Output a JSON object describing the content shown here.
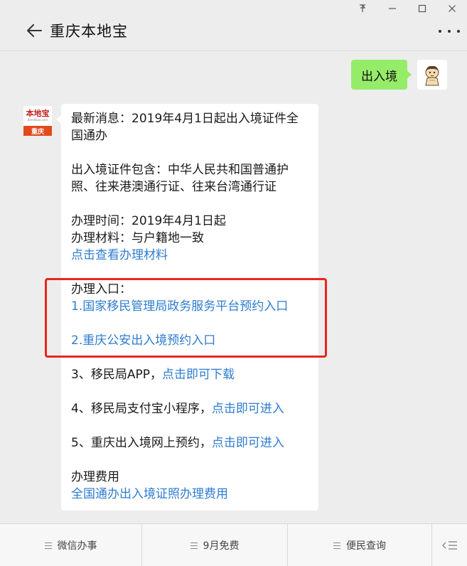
{
  "header": {
    "title": "重庆本地宝"
  },
  "chat": {
    "outgoing": {
      "text": "出入境"
    },
    "bot_avatar": {
      "logo_text": "本地宝",
      "logo_sub": "Bendibao.com",
      "city": "重庆"
    },
    "incoming": {
      "line1": "最新消息：2019年4月1日起出入境证件全",
      "line2": "国通办",
      "line3": "出入境证件包含：中华人民共和国普通护",
      "line4": "照、往来港澳通行证、往来台湾通行证",
      "line5": "办理时间：2019年4月1日起",
      "line6": "办理材料：与户籍地一致",
      "link_materials": "点击查看办理材料",
      "entry_heading": "办理入口：",
      "link_entry1": "1.国家移民管理局政务服务平台预约入口",
      "link_entry2": "2.重庆公安出入境预约入口",
      "item3_text": "3、移民局APP，",
      "item3_link": "点击即可下载",
      "item4_text": "4、移民局支付宝小程序，",
      "item4_link": "点击即可进入",
      "item5_text": "5、重庆出入境网上预约，",
      "item5_link": "点击即可进入",
      "fee_heading": "办理费用",
      "link_fee": "全国通办出入境证照办理费用"
    }
  },
  "menu": {
    "item1": "微信办事",
    "item2": "9月免费",
    "item3": "便民查询"
  },
  "colors": {
    "bubble_out": "#95ec69",
    "link": "#2e7cd0",
    "highlight": "#e8261e",
    "background": "#ededed"
  }
}
